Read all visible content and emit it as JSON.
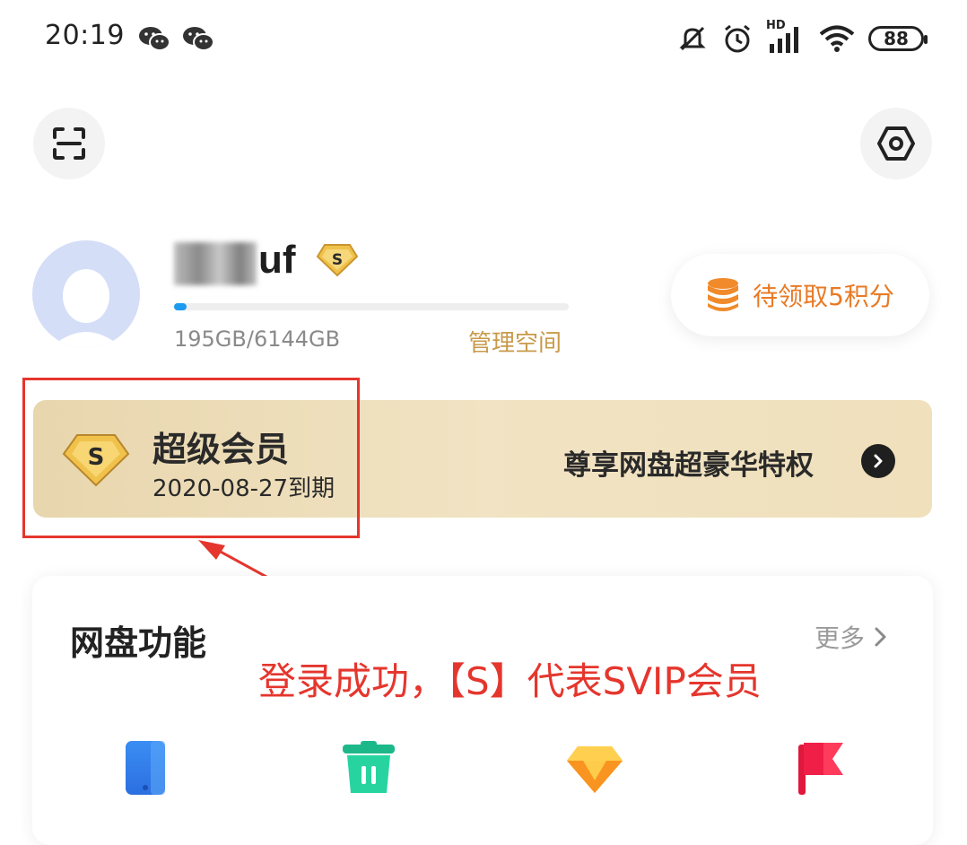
{
  "status_bar": {
    "time": "20:19",
    "icons": [
      "wechat-icon",
      "wechat-icon",
      "mute-icon",
      "alarm-icon",
      "hd-signal-icon",
      "wifi-icon"
    ],
    "signal_label": "HD",
    "battery": "88"
  },
  "header": {
    "scan_icon": "scan-icon",
    "settings_icon": "settings-icon"
  },
  "profile": {
    "username_visible": "uf",
    "badge_letter": "S",
    "quota_text": "195GB/6144GB",
    "quota_used_fraction": 0.0317,
    "manage_space_label": "管理空间",
    "points_label": "待领取5积分"
  },
  "vip_banner": {
    "badge_letter": "S",
    "title": "超级会员",
    "expiry": "2020-08-27到期",
    "privilege_text": "尊享网盘超豪华特权"
  },
  "features": {
    "title": "网盘功能",
    "more_label": "更多",
    "icons": [
      "phone-backup-icon",
      "recycle-bin-icon",
      "gem-icon",
      "flag-icon"
    ]
  },
  "annotation": {
    "text": "登录成功，【S】代表SVIP会员",
    "color": "#e5362d"
  },
  "colors": {
    "accent_gold": "#c89a4a",
    "points_orange": "#e87a25",
    "progress_blue": "#1e9af0"
  }
}
